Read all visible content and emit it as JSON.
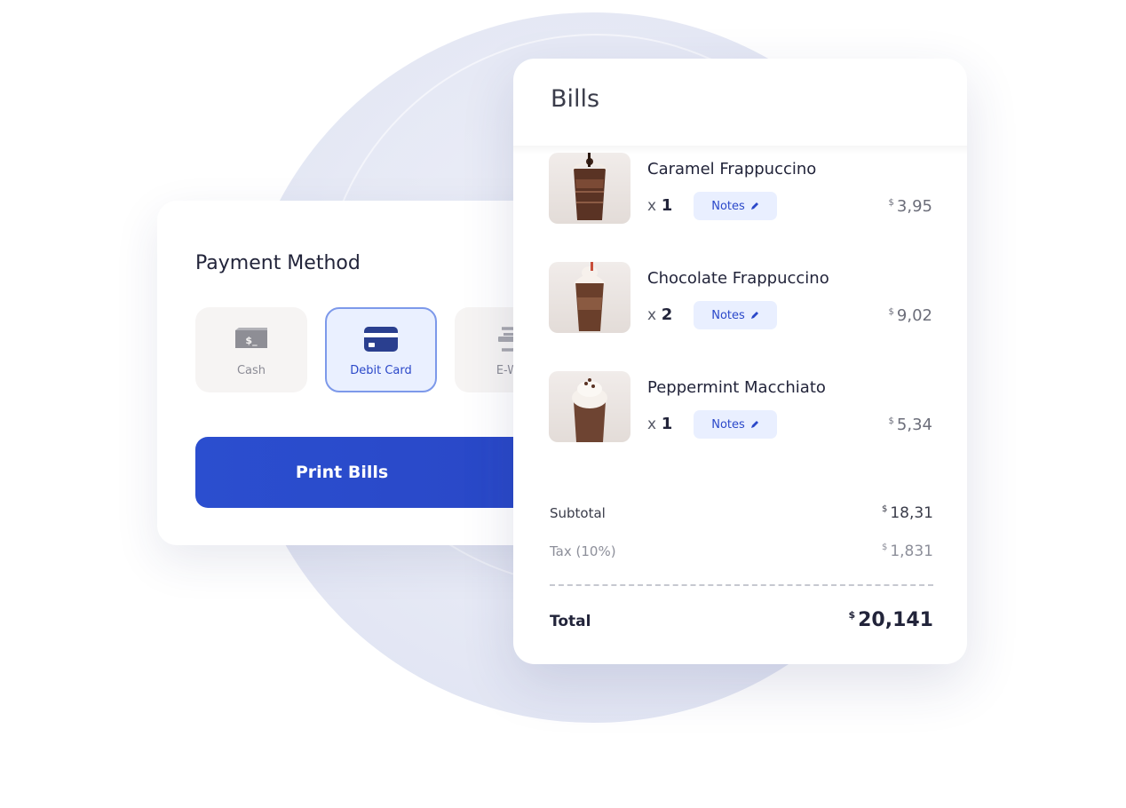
{
  "colors": {
    "primary": "#2b4ecf",
    "primary_light": "#e9efff",
    "selected_border": "#7d99ea",
    "background_circle": "#e6e9f5"
  },
  "payment": {
    "title": "Payment Method",
    "methods": [
      {
        "label": "Cash",
        "icon": "cash-icon",
        "selected": false
      },
      {
        "label": "Debit Card",
        "icon": "credit-card-icon",
        "selected": true
      },
      {
        "label": "E-Wa",
        "icon": "e-wallet-icon",
        "selected": false
      }
    ],
    "print_label": "Print Bills"
  },
  "bills": {
    "title": "Bills",
    "currency": "$",
    "items": [
      {
        "name": "Caramel Frappuccino",
        "qty_prefix": "x",
        "qty": "1",
        "notes_label": "Notes",
        "price": "3,95"
      },
      {
        "name": "Chocolate Frappuccino",
        "qty_prefix": "x",
        "qty": "2",
        "notes_label": "Notes",
        "price": "9,02"
      },
      {
        "name": "Peppermint Macchiato",
        "qty_prefix": "x",
        "qty": "1",
        "notes_label": "Notes",
        "price": "5,34"
      }
    ],
    "subtotal_label": "Subtotal",
    "subtotal": "18,31",
    "tax_label": "Tax (10%)",
    "tax": "1,831",
    "total_label": "Total",
    "total": "20,141"
  }
}
